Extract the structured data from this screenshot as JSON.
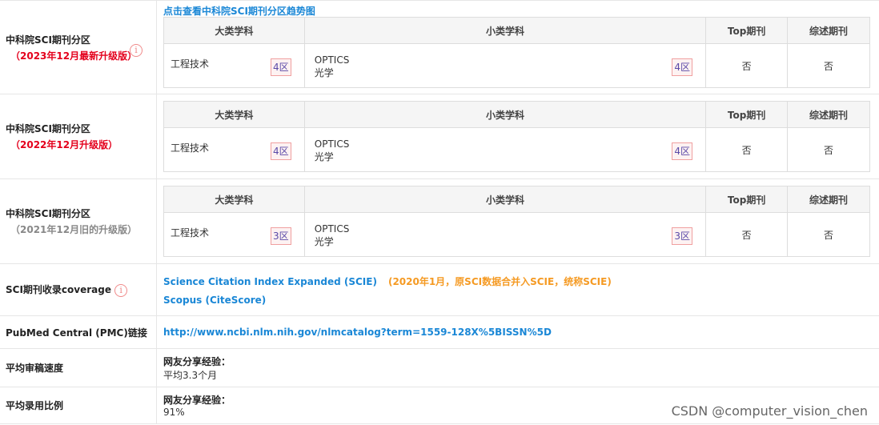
{
  "trend_link": "点击查看中科院SCI期刊分区趋势图",
  "partitions": [
    {
      "title": "中科院SCI期刊分区",
      "subtitle": "（2023年12月最新升级版）",
      "big_cat": "工程技术",
      "big_zone": "4区",
      "small_cat_en": "OPTICS",
      "small_cat_cn": "光学",
      "small_zone": "4区",
      "top": "否",
      "review": "否"
    },
    {
      "title": "中科院SCI期刊分区",
      "subtitle": "（2022年12月升级版）",
      "big_cat": "工程技术",
      "big_zone": "4区",
      "small_cat_en": "OPTICS",
      "small_cat_cn": "光学",
      "small_zone": "4区",
      "top": "否",
      "review": "否"
    },
    {
      "title": "中科院SCI期刊分区",
      "subtitle": "（2021年12月旧的升级版）",
      "big_cat": "工程技术",
      "big_zone": "3区",
      "small_cat_en": "OPTICS",
      "small_cat_cn": "光学",
      "small_zone": "3区",
      "top": "否",
      "review": "否"
    }
  ],
  "headers": {
    "big": "大类学科",
    "small": "小类学科",
    "top": "Top期刊",
    "review": "综述期刊"
  },
  "coverage": {
    "label": "SCI期刊收录coverage",
    "scie": "Science Citation Index Expanded (SCIE)",
    "note": "(2020年1月，原SCI数据合并入SCIE，统称SCIE)",
    "scopus": "Scopus (CiteScore)"
  },
  "pmc": {
    "label": "PubMed Central (PMC)链接",
    "url": "http://www.ncbi.nlm.nih.gov/nlmcatalog?term=1559-128X%5BISSN%5D"
  },
  "review_speed": {
    "label": "平均审稿速度",
    "title": "网友分享经验：",
    "value": "平均3.3个月"
  },
  "accept_rate": {
    "label": "平均录用比例",
    "title": "网友分享经验：",
    "value": "91%"
  },
  "info_icon": "i",
  "watermark": "CSDN @computer_vision_chen",
  "colors": {
    "link": "#1a87d6",
    "red": "#e4001c",
    "orange": "#f59a23"
  }
}
